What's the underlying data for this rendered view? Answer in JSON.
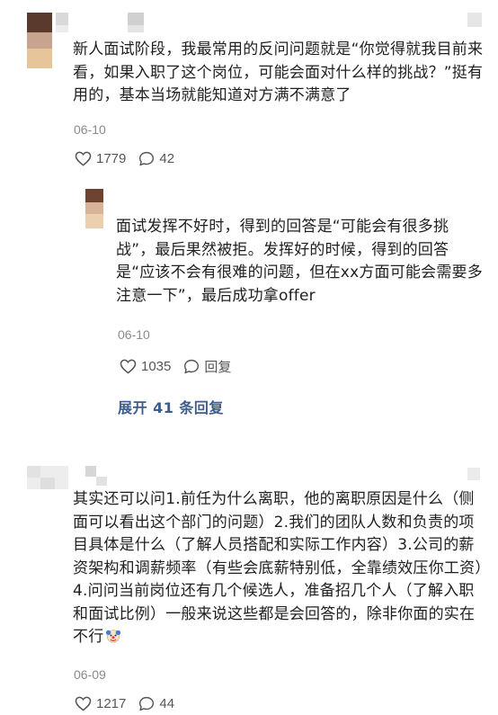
{
  "comments": [
    {
      "text": "新人面试阶段，我最常用的反问问题就是“你觉得就我目前来看，如果入职了这个岗位，可能会面对什么样的挑战？”挺有用的，基本当场就能知道对方满不满意了",
      "date": "06-10",
      "likes": "1779",
      "replies": "42"
    },
    {
      "text": "面试发挥不好时，得到的回答是“可能会有很多挑战”，最后果然被拒。发挥好的时候，得到的回答是“应该不会有很难的问题，但在xx方面可能会需要多注意一下”，最后成功拿offer",
      "date": "06-10",
      "likes": "1035",
      "reply_label": "回复"
    },
    {
      "text": "其实还可以问1.前任为什么离职，他的离职原因是什么（侧面可以看出这个部门的问题）2.我们的团队人数和负责的项目具体是什么（了解人员搭配和实际工作内容）3.公司的薪资架构和调薪频率（有些会底薪特别低，全靠绩效压你工资）4.问问当前岗位还有几个候选人，准备招几个人（了解入职和面试比例）一般来说这些都是会回答的，除非你面的实在不行",
      "emoji": "clown-face-icon",
      "date": "06-09",
      "likes": "1217",
      "replies": "44"
    }
  ],
  "expand_label": "展开 41 条回复",
  "icons": {
    "like": "heart-icon",
    "comment": "comment-bubble-icon"
  },
  "colors": {
    "text": "#1f1f1f",
    "meta": "#8a8a8a",
    "link": "#3d5d8c"
  }
}
